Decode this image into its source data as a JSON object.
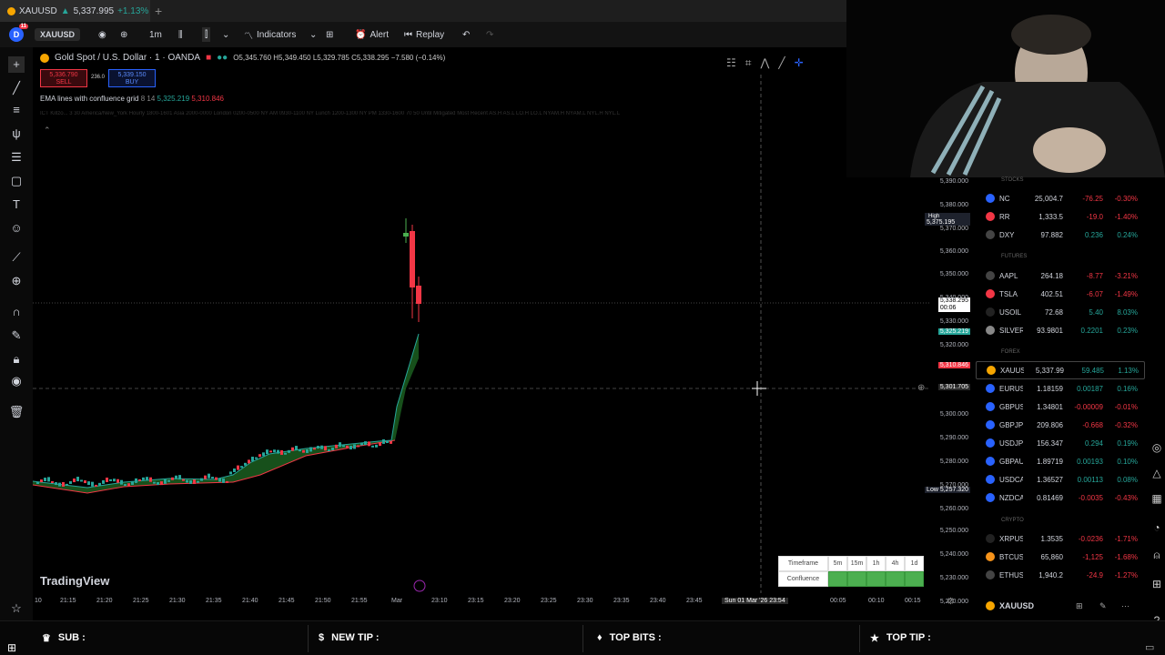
{
  "browser": {
    "tab_symbol": "XAUUSD",
    "tab_price": "5,337.995",
    "tab_change": "+1.13%",
    "new_tab": "+"
  },
  "toolbar": {
    "avatar_letter": "D",
    "avatar_badge": "11",
    "symbol": "XAUUSD",
    "interval": "1m",
    "indicators_label": "Indicators",
    "alert_label": "Alert",
    "replay_label": "Replay"
  },
  "chart": {
    "title": "Gold Spot / U.S. Dollar · 1 · OANDA",
    "ohlc": "O5,345.760 H5,349.450 L5,329.785 C5,338.295 −7.580 (−0.14%)",
    "sell_price": "5,336.790",
    "sell_label": "SELL",
    "spread": "236.0",
    "buy_price": "5,339.150",
    "buy_label": "BUY",
    "indicator_name": "EMA lines with confluence grid",
    "indicator_params": "8 14",
    "indicator_v1": "5,325.219",
    "indicator_v2": "5,310.846",
    "sessions_text": "ICT Killzo... 3 30 America/New_York Hourly 1800-1601 Asia 2000-0000 London 0200-0500 NY AM 0930-1100 NY Lunch 1200-1300 NY PM 1330-1600 70 50 Until Mitigated Most Recent AS.H AS.L LO.H LO.L NYAM.H NYAM.L NYL.H NYL.L",
    "price_ticks": [
      "5,390.000",
      "5,380.000",
      "5,370.000",
      "5,360.000",
      "5,350.000",
      "5,340.000",
      "5,330.000",
      "5,320.000",
      "5,300.000",
      "5,290.000",
      "5,280.000",
      "5,270.000",
      "5,260.000",
      "5,250.000",
      "5,240.000",
      "5,230.000",
      "5,220.000"
    ],
    "high_label": "High",
    "high_value": "5,375.195",
    "low_label": "Low",
    "low_value": "5,257.320",
    "current_price": "5,338.295",
    "countdown": "00:06",
    "ema_green_value": "5,325.219",
    "ema_red_value": "5,310.846",
    "crosshair_price": "5,301.705",
    "time_ticks": [
      "10",
      "21:15",
      "21:20",
      "21:25",
      "21:30",
      "21:35",
      "21:40",
      "21:45",
      "21:50",
      "21:55",
      "Mar",
      "23:10",
      "23:15",
      "23:20",
      "23:25",
      "23:30",
      "23:35",
      "23:40",
      "23:45",
      "00:05",
      "00:10",
      "00:15"
    ],
    "crosshair_time": "Sun 01 Mar '26   23:54",
    "logo_text": "TradingView",
    "confluence_table": {
      "header_label": "Timeframe",
      "row_label": "Confluence",
      "timeframes": [
        "5m",
        "15m",
        "1h",
        "4h",
        "1d"
      ],
      "row_color": "#4caf50"
    },
    "colors": {
      "up": "#26a69a",
      "down": "#f23645",
      "accent": "#2962ff"
    }
  },
  "watchlist": {
    "sections": {
      "stocks": "STOCKS",
      "futures": "FUTURES",
      "forex": "FOREX",
      "crypto": "CRYPTO"
    },
    "rows": [
      {
        "sym": "NC",
        "last": "25,004.7",
        "chg": "-76.25",
        "pct": "-0.30%",
        "neg": true,
        "color": "#2962ff"
      },
      {
        "sym": "RR",
        "last": "1,333.5",
        "chg": "-19.0",
        "pct": "-1.40%",
        "neg": true,
        "color": "#f23645"
      },
      {
        "sym": "DXY",
        "last": "97.882",
        "chg": "0.236",
        "pct": "0.24%",
        "neg": false,
        "color": "#444444"
      },
      {
        "sym": "AAPL",
        "last": "264.18",
        "chg": "-8.77",
        "pct": "-3.21%",
        "neg": true,
        "color": "#444444"
      },
      {
        "sym": "TSLA",
        "last": "402.51",
        "chg": "-6.07",
        "pct": "-1.49%",
        "neg": true,
        "color": "#f23645"
      },
      {
        "sym": "USOIL",
        "last": "72.68",
        "chg": "5.40",
        "pct": "8.03%",
        "neg": false,
        "color": "#222222"
      },
      {
        "sym": "SILVER",
        "last": "93.9801",
        "chg": "0.2201",
        "pct": "0.23%",
        "neg": false,
        "color": "#888888"
      },
      {
        "sym": "XAUUSD",
        "last": "5,337.99",
        "chg": "59.485",
        "pct": "1.13%",
        "neg": false,
        "color": "#f7a600"
      },
      {
        "sym": "EURUSD",
        "last": "1.18159",
        "chg": "0.00187",
        "pct": "0.16%",
        "neg": false,
        "color": "#2962ff"
      },
      {
        "sym": "GBPUSD",
        "last": "1.34801",
        "chg": "-0.00009",
        "pct": "-0.01%",
        "neg": true,
        "color": "#2962ff"
      },
      {
        "sym": "GBPJPY",
        "last": "209.806",
        "chg": "-0.668",
        "pct": "-0.32%",
        "neg": true,
        "color": "#2962ff"
      },
      {
        "sym": "USDJPY",
        "last": "156.347",
        "chg": "0.294",
        "pct": "0.19%",
        "neg": false,
        "color": "#2962ff"
      },
      {
        "sym": "GBPAUD",
        "last": "1.89719",
        "chg": "0.00193",
        "pct": "0.10%",
        "neg": false,
        "color": "#2962ff"
      },
      {
        "sym": "USDCAD",
        "last": "1.36527",
        "chg": "0.00113",
        "pct": "0.08%",
        "neg": false,
        "color": "#2962ff"
      },
      {
        "sym": "NZDCAD",
        "last": "0.81469",
        "chg": "-0.0035",
        "pct": "-0.43%",
        "neg": true,
        "color": "#2962ff"
      },
      {
        "sym": "XRPUSD",
        "last": "1.3535",
        "chg": "-0.0236",
        "pct": "-1.71%",
        "neg": true,
        "color": "#222222"
      },
      {
        "sym": "BTCUSD",
        "last": "65,860",
        "chg": "-1,125",
        "pct": "-1.68%",
        "neg": true,
        "color": "#f7931a"
      },
      {
        "sym": "ETHUSD",
        "last": "1,940.2",
        "chg": "-24.9",
        "pct": "-1.27%",
        "neg": true,
        "color": "#444444"
      }
    ],
    "footer_symbol": "XAUUSD"
  },
  "stream_bar": {
    "sub_label": "SUB :",
    "tip_label": "NEW TIP :",
    "bits_label": "TOP BITS :",
    "top_tip_label": "TOP TIP :"
  }
}
